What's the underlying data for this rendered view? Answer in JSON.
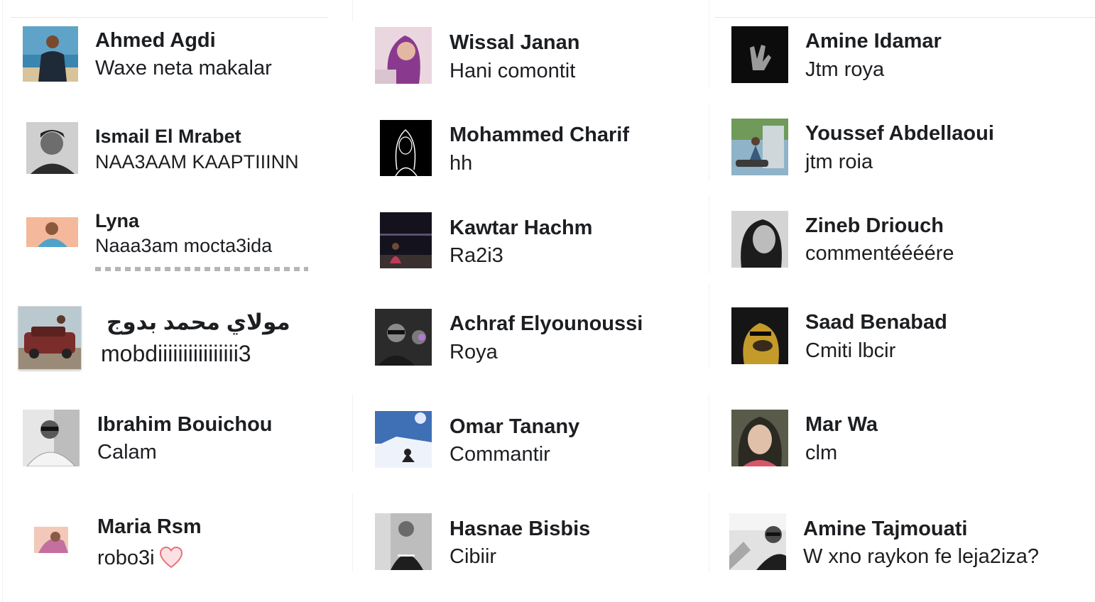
{
  "comments": [
    {
      "name": "Ahmed Agdi",
      "text": "Waxe neta makalar"
    },
    {
      "name": "Wissal Janan",
      "text": "Hani comontit"
    },
    {
      "name": "Amine Idamar",
      "text": "Jtm roya"
    },
    {
      "name": "Ismail El Mrabet",
      "text": "NAA3AAM KAAPTIIINN"
    },
    {
      "name": "Mohammed Charif",
      "text": "hh"
    },
    {
      "name": "Youssef Abdellaoui",
      "text": "jtm roia"
    },
    {
      "name": "Lyna",
      "text": "Naaa3am mocta3ida"
    },
    {
      "name": "Kawtar Hachm",
      "text": "Ra2i3"
    },
    {
      "name": "Zineb Driouch",
      "text": "commentéééére"
    },
    {
      "name": "مولاي محمد بدوج",
      "text": "mobdiiiiiiiiiiiiiiii3"
    },
    {
      "name": "Achraf Elyounoussi",
      "text": "Roya"
    },
    {
      "name": "Saad Benabad",
      "text": "Cmiti lbcir"
    },
    {
      "name": "Ibrahim Bouichou",
      "text": "Calam"
    },
    {
      "name": "Omar Tanany",
      "text": "Commantir"
    },
    {
      "name": "Mar Wa",
      "text": "clm"
    },
    {
      "name": "Maria Rsm",
      "text": "robo3i"
    },
    {
      "name": "Hasnae Bisbis",
      "text": "Cibiir"
    },
    {
      "name": "Amine Tajmouati",
      "text": "W xno raykon fe leja2iza?"
    }
  ],
  "colors": {
    "text": "#1c1e21",
    "heart": "#e8727c",
    "divider": "#e4e6eb"
  },
  "icons": {
    "heart": "heart-icon"
  }
}
